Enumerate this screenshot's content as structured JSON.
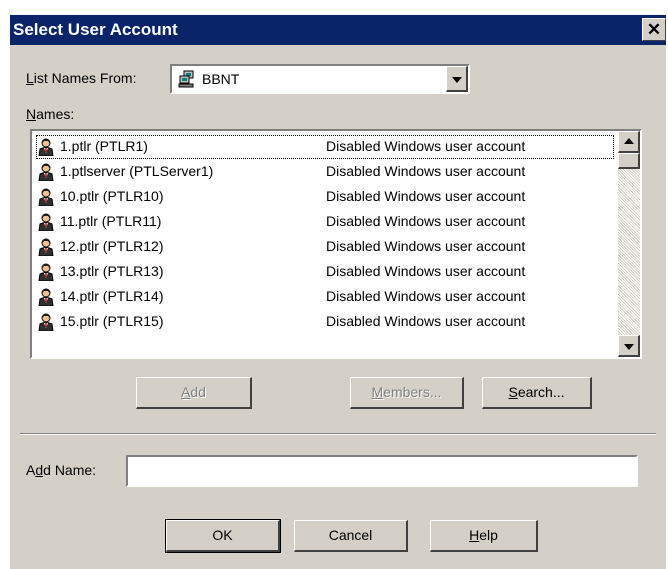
{
  "title": "Select User Account",
  "close_glyph": "✕",
  "list_from": {
    "label_pre": "",
    "label_accel": "L",
    "label_post": "ist Names From:",
    "value": "BBNT",
    "icon": "network-domain-icon"
  },
  "names": {
    "label_pre": "",
    "label_accel": "N",
    "label_post": "ames:",
    "items": [
      {
        "name": "1.ptlr (PTLR1)",
        "desc": "Disabled Windows user account"
      },
      {
        "name": "1.ptlserver (PTLServer1)",
        "desc": "Disabled Windows user account"
      },
      {
        "name": "10.ptlr (PTLR10)",
        "desc": "Disabled Windows user account"
      },
      {
        "name": "11.ptlr (PTLR11)",
        "desc": "Disabled Windows user account"
      },
      {
        "name": "12.ptlr (PTLR12)",
        "desc": "Disabled Windows user account"
      },
      {
        "name": "13.ptlr (PTLR13)",
        "desc": "Disabled Windows user account"
      },
      {
        "name": "14.ptlr (PTLR14)",
        "desc": "Disabled Windows user account"
      },
      {
        "name": "15.ptlr (PTLR15)",
        "desc": "Disabled Windows user account"
      }
    ],
    "item_icon": "user-account-icon"
  },
  "buttons": {
    "add": {
      "pre": "",
      "accel": "A",
      "post": "dd"
    },
    "members": {
      "pre": "",
      "accel": "M",
      "post": "embers..."
    },
    "search": {
      "pre": "",
      "accel": "S",
      "post": "earch..."
    },
    "ok": "OK",
    "cancel": "Cancel",
    "help": {
      "pre": "",
      "accel": "H",
      "post": "elp"
    }
  },
  "add_name": {
    "label_pre": "A",
    "label_accel": "d",
    "label_post": "d Name:",
    "value": ""
  },
  "colors": {
    "titlebar": "#0a246a",
    "face": "#d4d0c8"
  }
}
